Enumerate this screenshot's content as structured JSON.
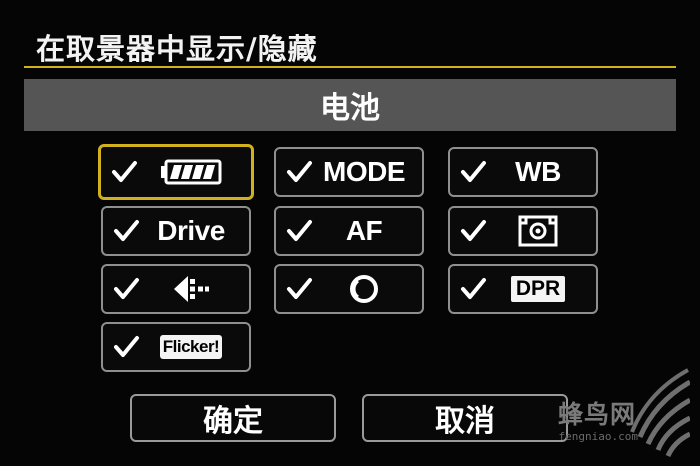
{
  "header": {
    "title": "在取景器中显示/隐藏"
  },
  "selected_label": "电池",
  "items": [
    {
      "name": "battery",
      "checked": true,
      "icon": "battery-icon"
    },
    {
      "name": "mode",
      "checked": true,
      "label": "MODE"
    },
    {
      "name": "wb",
      "checked": true,
      "label": "WB"
    },
    {
      "name": "drive",
      "checked": true,
      "label": "Drive"
    },
    {
      "name": "af",
      "checked": true,
      "label": "AF"
    },
    {
      "name": "metering",
      "checked": true,
      "icon": "metering-icon"
    },
    {
      "name": "file-format",
      "checked": true,
      "icon": "file-format-icon"
    },
    {
      "name": "flicker-detection",
      "checked": true,
      "icon": "flicker-detection-icon"
    },
    {
      "name": "dpr",
      "checked": true,
      "label": "DPR"
    },
    {
      "name": "flicker",
      "checked": true,
      "label": "Flicker!"
    }
  ],
  "buttons": {
    "ok": "确定",
    "cancel": "取消"
  },
  "watermark": {
    "text": "蜂鸟网",
    "sub": "fengniao.com"
  },
  "colors": {
    "accent": "#d2b21c",
    "bar": "#555555",
    "border": "#8f8f8f"
  }
}
